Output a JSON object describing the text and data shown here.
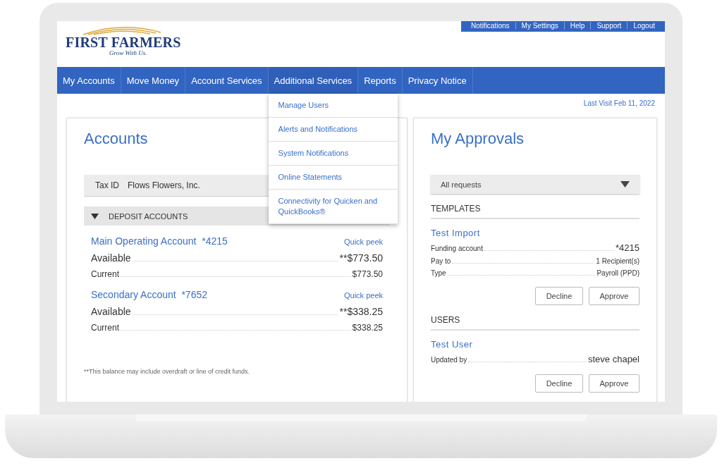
{
  "utility_links": [
    "Notifications",
    "My Settings",
    "Help",
    "Support",
    "Logout"
  ],
  "logo": {
    "name": "FIRST FARMERS",
    "tagline": "Grow With Us."
  },
  "nav": [
    {
      "label": "My Accounts"
    },
    {
      "label": "Move Money"
    },
    {
      "label": "Account Services"
    },
    {
      "label": "Additional Services",
      "expanded": true,
      "menu": [
        "Manage Users",
        "Alerts and Notifications",
        "System Notifications",
        "Online Statements",
        "Connectivity for Quicken and QuickBooks®"
      ]
    },
    {
      "label": "Reports"
    },
    {
      "label": "Privacy Notice"
    }
  ],
  "last_visit": "Last Visit Feb 11, 2022",
  "accounts": {
    "title": "Accounts",
    "tax_id_label": "Tax ID",
    "tax_id_value": "Flows Flowers, Inc.",
    "group": {
      "label": "DEPOSIT ACCOUNTS",
      "expanded": true
    },
    "items": [
      {
        "name": "Main Operating Account",
        "number": "*4215",
        "link": "Quick peek",
        "rows": [
          {
            "label": "Available",
            "value": "**$773.50",
            "kind": "large"
          },
          {
            "label": "Current",
            "value": "$773.50",
            "kind": "small"
          }
        ]
      },
      {
        "name": "Secondary Account",
        "number": "*7652",
        "link": "Quick peek",
        "rows": [
          {
            "label": "Available",
            "value": "**$338.25",
            "kind": "large"
          },
          {
            "label": "Current",
            "value": "$338.25",
            "kind": "small"
          }
        ]
      }
    ],
    "footnote": "**This balance may include overdraft or line of credit funds."
  },
  "approvals": {
    "title": "My Approvals",
    "filter": "All requests",
    "sections": [
      {
        "heading": "TEMPLATES",
        "name": "Test Import",
        "rows": [
          {
            "label": "Funding account",
            "value": "*4215",
            "kind": "large"
          },
          {
            "label": "Pay to",
            "value": "1 Recipient(s)",
            "kind": "small"
          },
          {
            "label": "Type",
            "value": "Payroll (PPD)",
            "kind": "small"
          }
        ],
        "buttons": [
          "Decline",
          "Approve"
        ]
      },
      {
        "heading": "USERS",
        "name": "Test User",
        "rows": [
          {
            "label": "Updated by",
            "value": "steve chapel",
            "kind": "large"
          }
        ],
        "buttons": [
          "Decline",
          "Approve"
        ]
      }
    ]
  }
}
